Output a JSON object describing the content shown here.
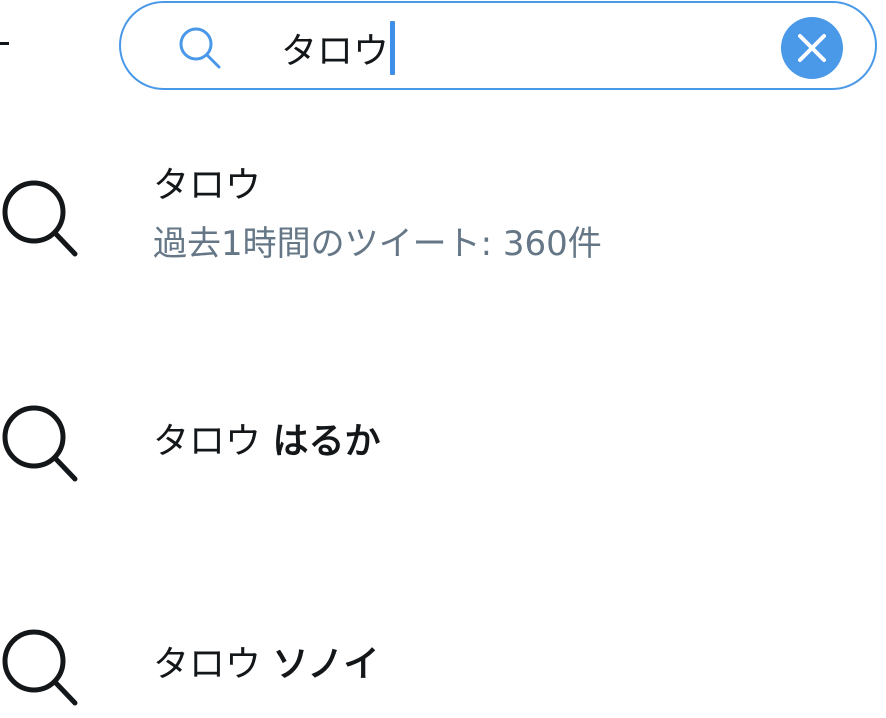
{
  "search": {
    "query": "タロウ",
    "search_icon": "search-icon",
    "clear_icon": "close-icon",
    "accent_color": "#4a99e9"
  },
  "suggestions": [
    {
      "icon": "search-icon",
      "title": "タロウ",
      "subtitle": "過去1時間のツイート: 360件"
    },
    {
      "icon": "search-icon",
      "prefix": "タロウ",
      "suffix": "はるか"
    },
    {
      "icon": "search-icon",
      "prefix": "タロウ",
      "suffix": "ソノイ"
    }
  ]
}
